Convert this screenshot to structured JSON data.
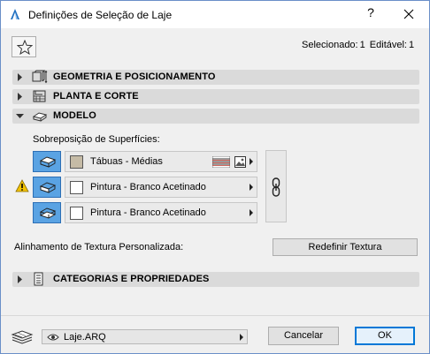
{
  "window": {
    "title": "Definições de Seleção de Laje",
    "help_label": "?",
    "colors": {
      "border": "#6a8fc8",
      "accent": "#0078d7",
      "surface_button": "#5aa3e3",
      "panel_header": "#dadada"
    }
  },
  "selection_info": {
    "selected_label": "Selecionado:",
    "selected_count": "1",
    "editable_label": "Editável:",
    "editable_count": "1"
  },
  "panels": {
    "geometry": {
      "label": "GEOMETRIA E POSICIONAMENTO",
      "icon": "geometry-icon",
      "expanded": false
    },
    "plan": {
      "label": "PLANTA E CORTE",
      "icon": "floor-plan-icon",
      "expanded": false
    },
    "model": {
      "label": "MODELO",
      "icon": "model-icon",
      "expanded": true
    },
    "categories": {
      "label": "CATEGORIAS E PROPRIEDADES",
      "icon": "document-icon",
      "expanded": false
    }
  },
  "model": {
    "surface_override_label": "Sobreposição de Superfícies:",
    "surfaces": [
      {
        "part": "top-surface",
        "material": "Tábuas - Médias",
        "swatch_color": "#c5bba6"
      },
      {
        "part": "edge-surface",
        "material": "Pintura - Branco Acetinado",
        "swatch_color": "#ffffff"
      },
      {
        "part": "bottom-surface",
        "material": "Pintura - Branco Acetinado",
        "swatch_color": "#ffffff"
      }
    ],
    "texture_alignment_label": "Alinhamento de Textura Personalizada:",
    "reset_texture_label": "Redefinir Textura"
  },
  "footer": {
    "layer_name": "Laje.ARQ",
    "cancel_label": "Cancelar",
    "ok_label": "OK"
  }
}
